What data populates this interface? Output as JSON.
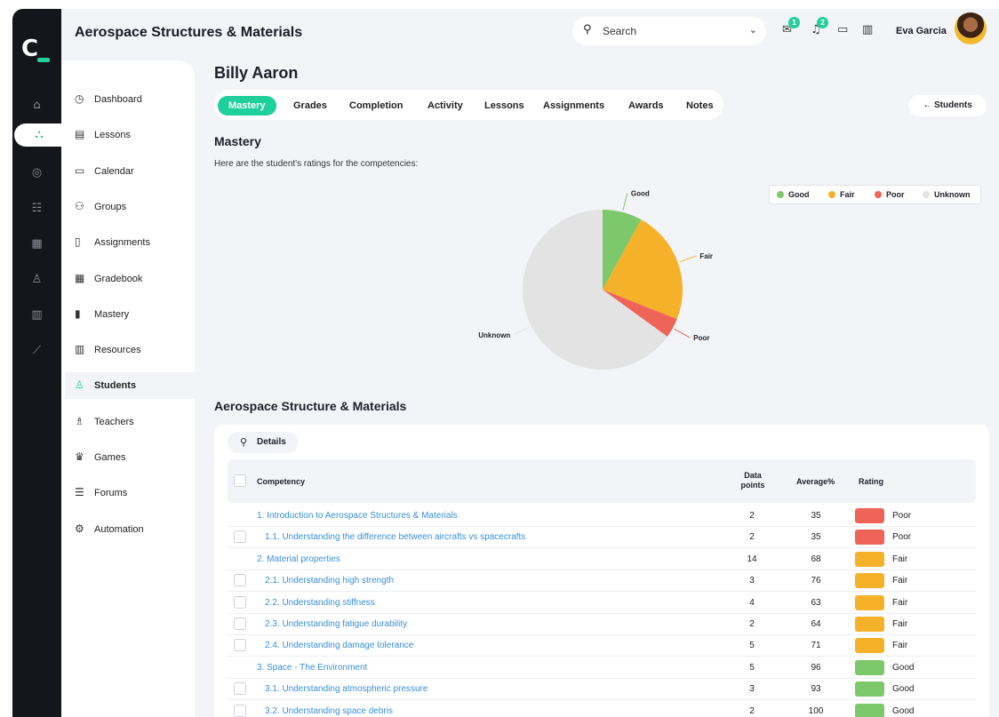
{
  "app": {
    "title": "Aerospace Structures & Materials",
    "logo_text": "C"
  },
  "search": {
    "placeholder": "Search"
  },
  "header": {
    "messages_badge": "1",
    "notifications_badge": "2",
    "user_name": "Eva Garcia"
  },
  "rail_icons": [
    "home-icon",
    "students-icon",
    "palette-icon",
    "users-icon",
    "grid-icon",
    "user-icon",
    "books-icon",
    "chart-icon"
  ],
  "nav": [
    {
      "label": "Dashboard",
      "icon": "dashboard-icon"
    },
    {
      "label": "Lessons",
      "icon": "lessons-icon"
    },
    {
      "label": "Calendar",
      "icon": "calendar-icon"
    },
    {
      "label": "Groups",
      "icon": "groups-icon"
    },
    {
      "label": "Assignments",
      "icon": "assignments-icon"
    },
    {
      "label": "Gradebook",
      "icon": "gradebook-icon"
    },
    {
      "label": "Mastery",
      "icon": "mastery-icon"
    },
    {
      "label": "Resources",
      "icon": "resources-icon"
    },
    {
      "label": "Students",
      "icon": "students-icon"
    },
    {
      "label": "Teachers",
      "icon": "teachers-icon"
    },
    {
      "label": "Games",
      "icon": "games-icon"
    },
    {
      "label": "Forums",
      "icon": "forums-icon"
    },
    {
      "label": "Automation",
      "icon": "automation-icon"
    }
  ],
  "student_name": "Billy Aaron",
  "tabs": [
    "Mastery",
    "Grades",
    "Completion",
    "Activity",
    "Lessons",
    "Assignments",
    "Awards",
    "Notes"
  ],
  "back_button": "← Students",
  "mastery": {
    "title": "Mastery",
    "description": "Here are the student's ratings for the competencies:"
  },
  "colors": {
    "good": "#7cc86a",
    "fair": "#f6b12b",
    "poor": "#ee6459",
    "unknown": "#e3e3e3",
    "accent": "#1fcf9c"
  },
  "chart_data": {
    "type": "pie",
    "slices": [
      {
        "label": "Good",
        "value": 8
      },
      {
        "label": "Fair",
        "value": 23
      },
      {
        "label": "Poor",
        "value": 4
      },
      {
        "label": "Unknown",
        "value": 65
      }
    ],
    "legend": [
      "Good",
      "Fair",
      "Poor",
      "Unknown"
    ],
    "legend_position": "top-right"
  },
  "table": {
    "title": "Aerospace Structure & Materials",
    "details_button": "Details",
    "headers": {
      "competency": "Competency",
      "data_points": "Data points",
      "average": "Average%",
      "rating": "Rating"
    },
    "rows": [
      {
        "competency": "1. Introduction to Aerospace Structures & Materials",
        "data_points": "2",
        "average": "35",
        "rating": "Poor",
        "level": 0
      },
      {
        "competency": "1.1. Understanding the difference between aircrafts vs spacecrafts",
        "data_points": "2",
        "average": "35",
        "rating": "Poor",
        "level": 1
      },
      {
        "competency": "2. Material properties",
        "data_points": "14",
        "average": "68",
        "rating": "Fair",
        "level": 0
      },
      {
        "competency": "2.1. Understanding high strength",
        "data_points": "3",
        "average": "76",
        "rating": "Fair",
        "level": 1
      },
      {
        "competency": "2.2. Understanding stiffness",
        "data_points": "4",
        "average": "63",
        "rating": "Fair",
        "level": 1
      },
      {
        "competency": "2.3. Understanding fatigue durability",
        "data_points": "2",
        "average": "64",
        "rating": "Fair",
        "level": 1
      },
      {
        "competency": "2.4. Understanding damage tolerance",
        "data_points": "5",
        "average": "71",
        "rating": "Fair",
        "level": 1
      },
      {
        "competency": "3. Space - The Environment",
        "data_points": "5",
        "average": "96",
        "rating": "Good",
        "level": 0
      },
      {
        "competency": "3.1. Understanding atmospheric pressure",
        "data_points": "3",
        "average": "93",
        "rating": "Good",
        "level": 1
      },
      {
        "competency": "3.2. Understanding space debris",
        "data_points": "2",
        "average": "100",
        "rating": "Good",
        "level": 1
      }
    ]
  }
}
